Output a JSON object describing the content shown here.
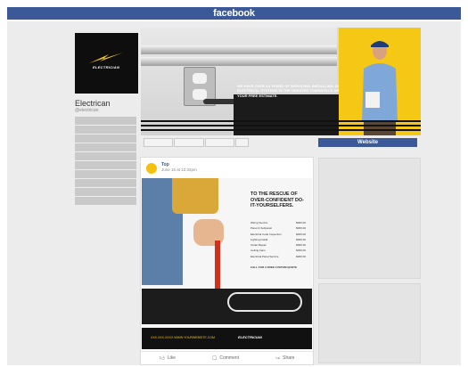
{
  "topbar": {
    "brand": "facebook"
  },
  "page": {
    "name": "Electrican",
    "handle": "@electrican",
    "logo_text": "ELECTRICIAN",
    "side_menu_items": [
      "",
      "",
      "",
      "",
      "",
      "",
      "",
      "",
      "",
      ""
    ]
  },
  "cover": {
    "text": "WE HAVE OVER XX YEARS OF SERVICING, INSTALLING, AND INSPECTING ELECTRICAL SYSTEMS IN THE GREATER TOWNSVILLE AREA. CALL US FOR YOUR FREE ESTIMATE."
  },
  "actions": {
    "website_label": "Website"
  },
  "post": {
    "author": "Top",
    "time": "June 15 at 12:32pm",
    "headline": "TO THE RESCUE OF OVER-CONFIDENT DO-IT-YOURSELFERS.",
    "prices": [
      {
        "service": "Wiring Service",
        "price": "$000.00"
      },
      {
        "service": "Panel & Subpanel",
        "price": "$000.00"
      },
      {
        "service": "Electrical Code Inspection",
        "price": "$000.00"
      },
      {
        "service": "Lighting Install",
        "price": "$000.00"
      },
      {
        "service": "Outlet Repair",
        "price": "$000.00"
      },
      {
        "service": "Ceiling Fans",
        "price": "$000.00"
      },
      {
        "service": "Electrical Panel Service",
        "price": "$000.00"
      }
    ],
    "cta": "CALL FOR A FREE CUSTOM QUOTE",
    "footer_text": "XXX.XXX.XXXX   WWW.YOURWEBSITE.COM",
    "footer_logo": "ELECTRICIAN",
    "like_label": "Like",
    "comment_label": "Comment",
    "share_label": "Share"
  },
  "colors": {
    "facebook_blue": "#3b5998",
    "brand_yellow": "#f6c816",
    "dark": "#111111"
  }
}
